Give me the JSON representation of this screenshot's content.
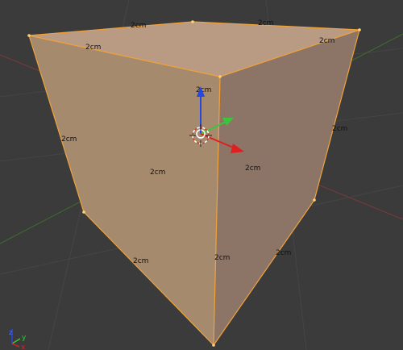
{
  "scene": {
    "dimension_label": "2cm",
    "colors": {
      "background": "#3b3b3b",
      "grid": "#454545",
      "x_axis_line": "#7a3a3a",
      "y_axis_line": "#3f6a2f",
      "top_face": "#b99a82",
      "left_face": "#a68a6d",
      "right_face": "#8c7567",
      "selection_edge": "#f0a23a",
      "gizmo_x": "#e02020",
      "gizmo_y": "#3cc43c",
      "gizmo_z": "#2448e0",
      "cursor_red": "#d23a2a"
    }
  },
  "orientation_axes": {
    "x_label": "x",
    "y_label": "y",
    "z_label": "z"
  }
}
